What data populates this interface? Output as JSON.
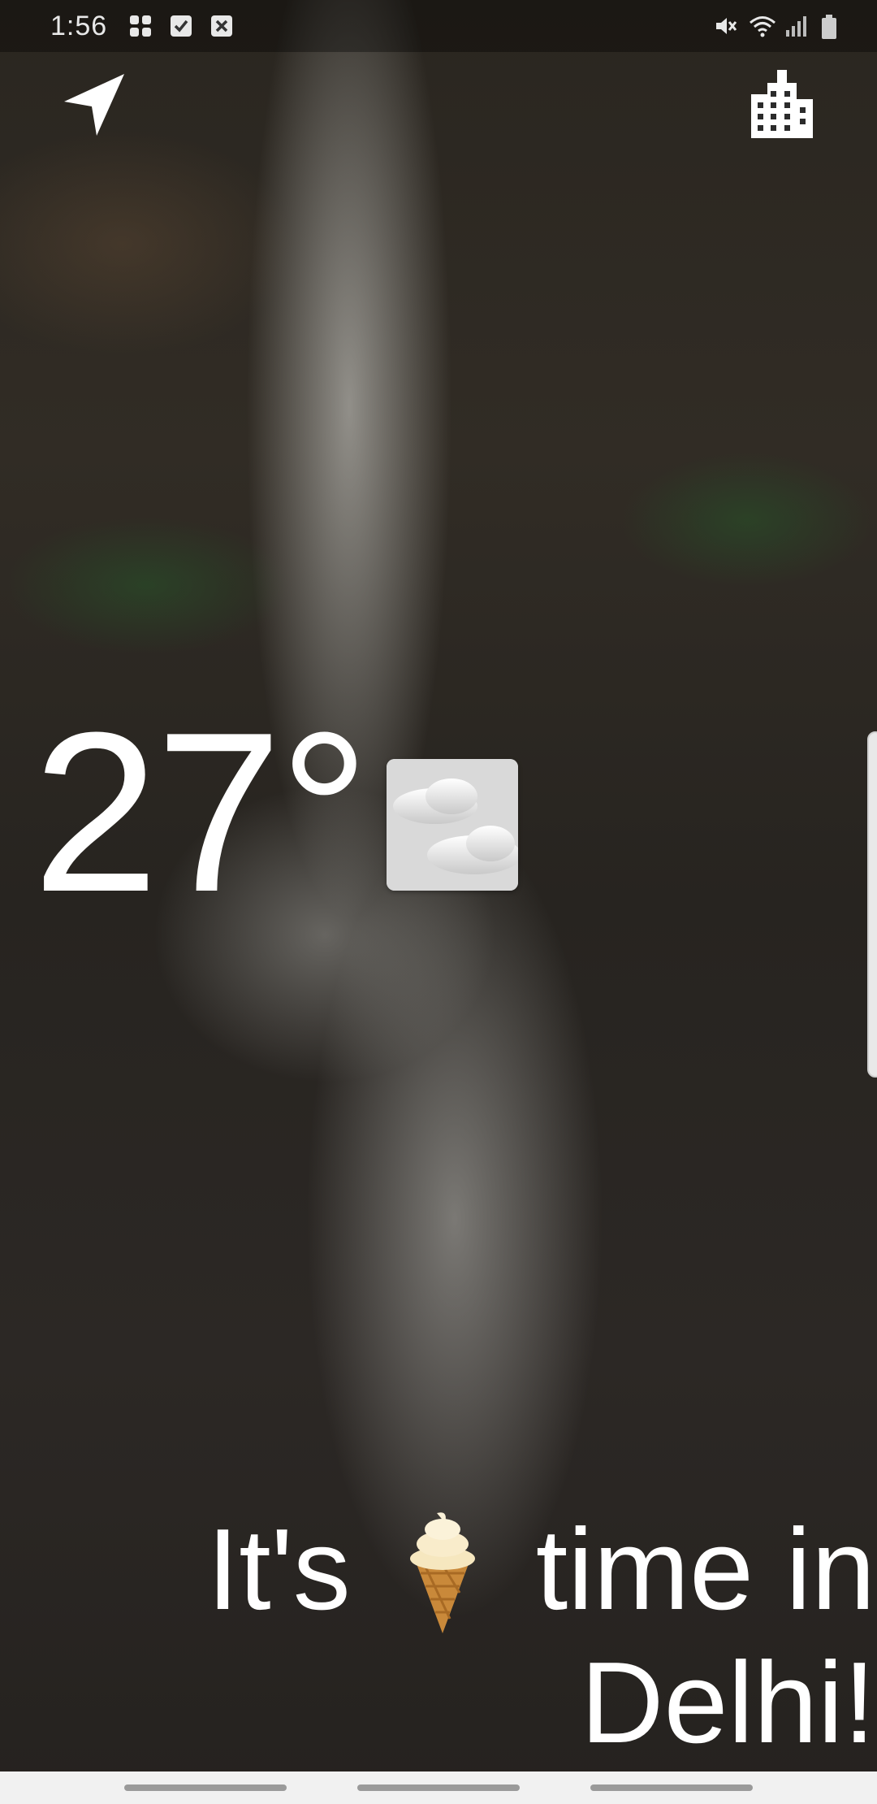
{
  "status_bar": {
    "time": "1:56",
    "left_icons": [
      "dual-sim-icon",
      "checkbox-icon",
      "close-box-icon"
    ],
    "right_icons": [
      "mute-icon",
      "wifi-icon",
      "signal-icon",
      "battery-icon"
    ]
  },
  "top_actions": {
    "location_icon": "navigation-arrow-icon",
    "city_icon": "city-buildings-icon"
  },
  "weather": {
    "temperature": "27°",
    "condition_icon": "cloudy-icon"
  },
  "message": {
    "line1_part1": "It's",
    "emoji": "ice-cream-icon",
    "line1_part2": "time in",
    "line2": "Delhi!"
  },
  "colors": {
    "text": "#ffffff",
    "nav_bar": "#f1f1f1"
  }
}
